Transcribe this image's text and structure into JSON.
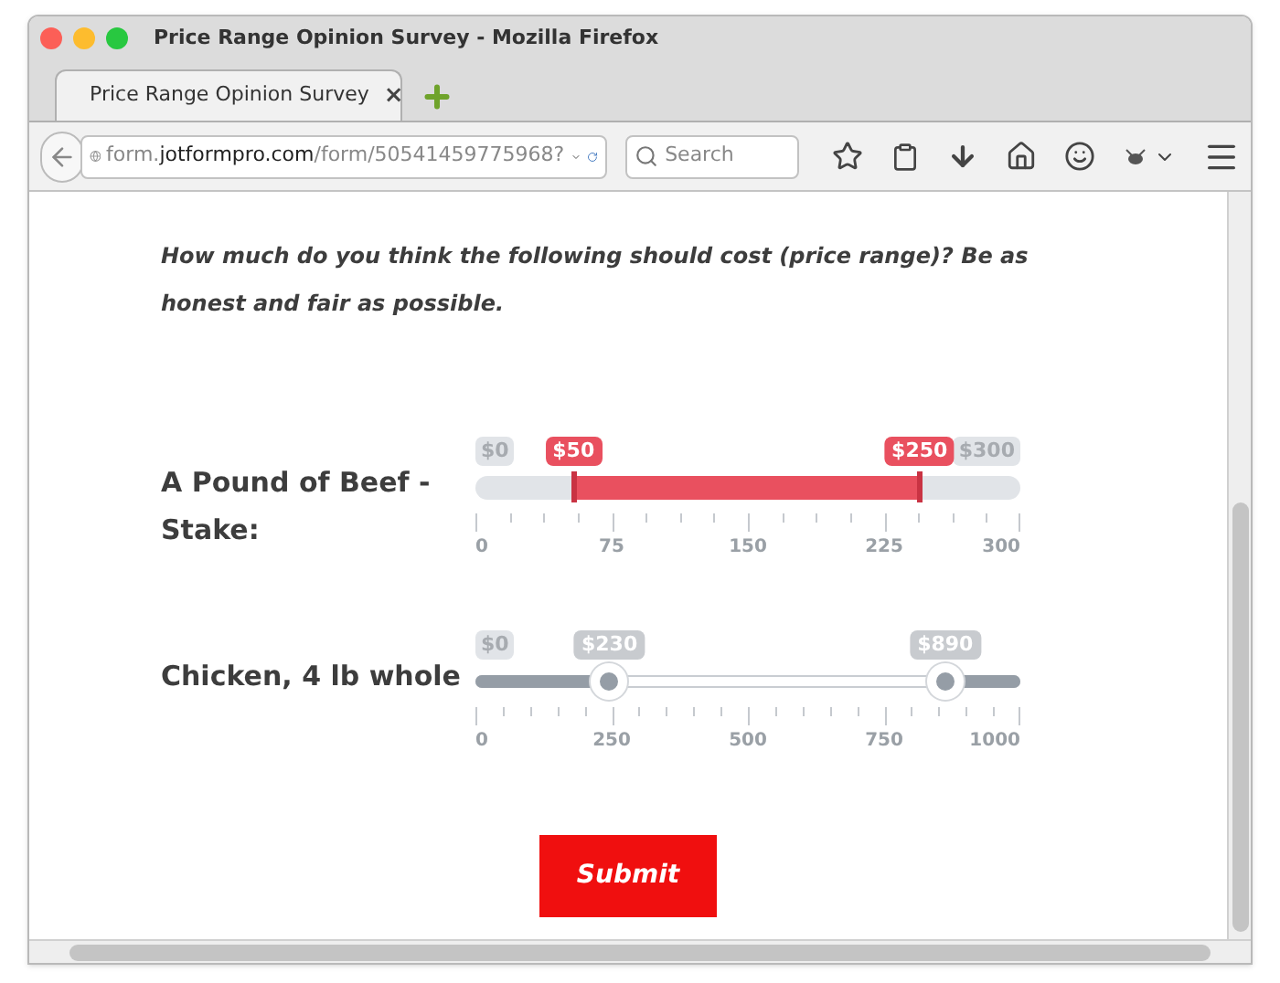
{
  "window": {
    "title": "Price Range Opinion Survey - Mozilla Firefox"
  },
  "tabs": [
    {
      "label": "Price Range Opinion Survey",
      "selected": true,
      "close": "×"
    }
  ],
  "toolbar": {
    "url_host_pre": "form.",
    "url_host": "jotformpro.com",
    "url_path": "/form/50541459775968?",
    "search_placeholder": "Search"
  },
  "question": "How much do you think the following should cost (price range)? Be as honest and fair as possible.",
  "sliders": [
    {
      "kind": "flat",
      "label": "A Pound of Beef - Stake:",
      "min_label": "$0",
      "max_label": "$300",
      "handles": [
        {
          "label": "$50",
          "level": 0.18
        },
        {
          "label": "$250",
          "level": 0.815
        }
      ],
      "ticks": [
        "0",
        "75",
        "150",
        "225",
        "300"
      ]
    },
    {
      "kind": "round",
      "label": "Chicken, 4 lb whole",
      "min_label": "$0",
      "handles": [
        {
          "label": "$230",
          "level": 0.246
        },
        {
          "label": "$890",
          "level": 0.862
        }
      ],
      "ticks": [
        "0",
        "250",
        "500",
        "750",
        "1000"
      ]
    }
  ],
  "submit": "Submit"
}
